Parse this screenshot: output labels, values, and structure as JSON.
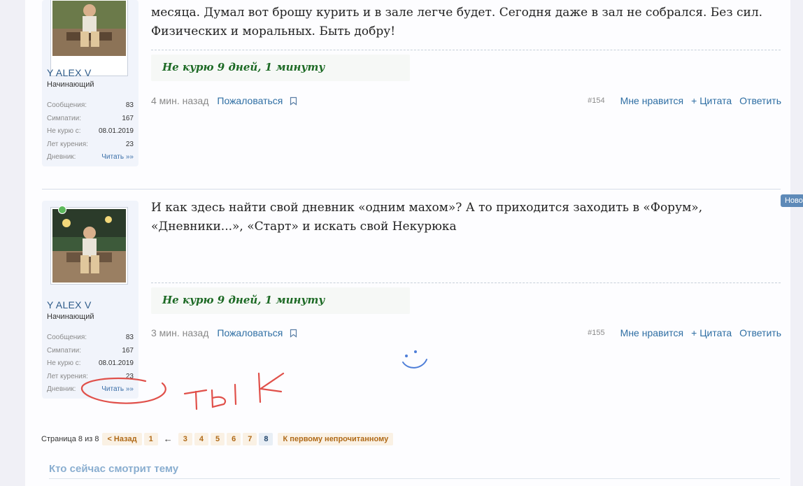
{
  "posts": [
    {
      "partial_text": "месяца. Думал вот брошу курить и в зале легче будет. Сегодня даже в зал не собрался. Без сил. Физических и моральных. Быть добру!",
      "user": {
        "name": "Y ALEX V",
        "title": "Начинающий",
        "stats": [
          {
            "label": "Сообщения:",
            "value": "83"
          },
          {
            "label": "Симпатии:",
            "value": "167"
          },
          {
            "label": "Не курю с:",
            "value": "08.01.2019"
          },
          {
            "label": "Лет курения:",
            "value": "23"
          },
          {
            "label": "Дневник:",
            "value": "Читать »»"
          }
        ]
      },
      "signature": "Не курю 9 дней, 1 минуту",
      "time": "4 мин. назад",
      "report": "Пожаловаться",
      "number": "#154",
      "like": "Мне нравится",
      "quote": "+ Цитата",
      "reply": "Ответить"
    },
    {
      "text": "И как здесь найти свой дневник «одним махом»? А то приходится заходить в «Форум», «Дневники...», «Старт» и искать свой Некурюка",
      "badge": "Новое",
      "user": {
        "name": "Y ALEX V",
        "title": "Начинающий",
        "stats": [
          {
            "label": "Сообщения:",
            "value": "83"
          },
          {
            "label": "Симпатии:",
            "value": "167"
          },
          {
            "label": "Не курю с:",
            "value": "08.01.2019"
          },
          {
            "label": "Лет курения:",
            "value": "23"
          },
          {
            "label": "Дневник:",
            "value": "Читать »»"
          }
        ]
      },
      "signature": "Не курю 9 дней, 1 минуту",
      "time": "3 мин. назад",
      "report": "Пожаловаться",
      "number": "#155",
      "like": "Мне нравится",
      "quote": "+ Цитата",
      "reply": "Ответить"
    }
  ],
  "pagination": {
    "info": "Страница 8 из 8",
    "prev": "< Назад",
    "pages": [
      "1",
      "←",
      "3",
      "4",
      "5",
      "6",
      "7",
      "8"
    ],
    "current": "8",
    "first_unread": "К первому непрочитанному"
  },
  "viewing_title": "Кто сейчас смотрит тему",
  "colors": {
    "link": "#2e6ea3",
    "signature": "#1d6a25",
    "annotation": "#e0504a"
  },
  "annotation_text": "ТЫК"
}
